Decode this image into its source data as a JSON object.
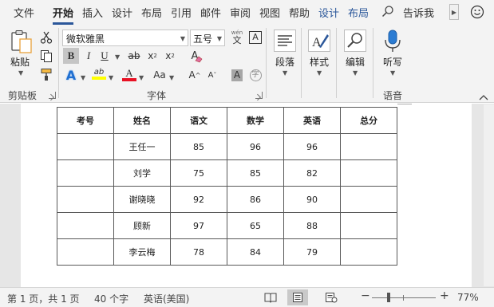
{
  "tabs": [
    {
      "label": "文件",
      "active": false
    },
    {
      "label": "开始",
      "active": true
    },
    {
      "label": "插入",
      "active": false
    },
    {
      "label": "设计",
      "active": false
    },
    {
      "label": "布局",
      "active": false
    },
    {
      "label": "引用",
      "active": false
    },
    {
      "label": "邮件",
      "active": false
    },
    {
      "label": "审阅",
      "active": false
    },
    {
      "label": "视图",
      "active": false
    },
    {
      "label": "帮助",
      "active": false
    },
    {
      "label": "设计",
      "active": false,
      "contextual": true
    },
    {
      "label": "布局",
      "active": false,
      "contextual": true
    }
  ],
  "tell_me": "告诉我",
  "ribbon": {
    "clipboard": {
      "paste_label": "粘贴",
      "group_label": "剪贴板"
    },
    "font": {
      "font_name": "微软雅黑",
      "font_size": "五号",
      "group_label": "字体",
      "wen_glyph": "wén",
      "wen_char": "文",
      "boxed_a": "A",
      "bold": "B",
      "italic": "I",
      "underline": "U",
      "strike": "ab",
      "subscript_base": "x",
      "subscript_mark": "2",
      "superscript_base": "x",
      "superscript_mark": "2",
      "change_case": "Aa",
      "grow": "A",
      "shrink": "A",
      "shade_a": "A",
      "enclose_char": "字",
      "clear_a": "A",
      "highlight_letter": "ab",
      "font_color_letter": "A",
      "text_effect_letter": "A",
      "highlight_color": "#ffff00",
      "font_color": "#e81123",
      "text_effect_color": "#1f6fd1"
    },
    "paragraph": {
      "label": "段落"
    },
    "styles": {
      "label": "样式"
    },
    "editing": {
      "label": "编辑"
    },
    "voice": {
      "button_label": "听写",
      "group_label": "语音"
    }
  },
  "table": {
    "headers": [
      "考号",
      "姓名",
      "语文",
      "数学",
      "英语",
      "总分"
    ],
    "rows": [
      [
        "",
        "王任一",
        "85",
        "96",
        "96",
        ""
      ],
      [
        "",
        "刘学",
        "75",
        "85",
        "82",
        ""
      ],
      [
        "",
        "谢晓晓",
        "92",
        "86",
        "90",
        ""
      ],
      [
        "",
        "顾新",
        "97",
        "65",
        "88",
        ""
      ],
      [
        "",
        "李云梅",
        "78",
        "84",
        "79",
        ""
      ]
    ]
  },
  "status": {
    "page": "第 1 页，共 1 页",
    "words": "40 个字",
    "language": "英语(美国)",
    "zoom": "77%",
    "zoom_minus": "−",
    "zoom_plus": "+"
  },
  "colors": {
    "accent": "#2b579a"
  }
}
